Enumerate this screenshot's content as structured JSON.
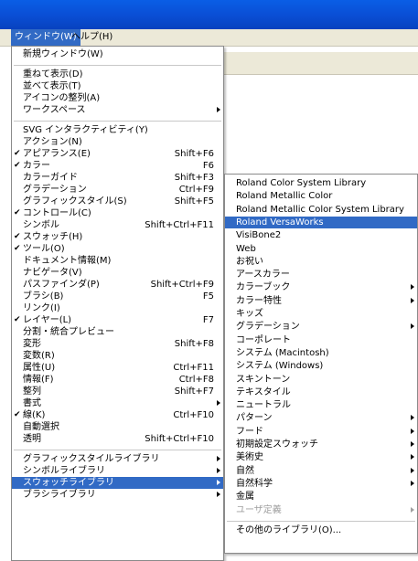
{
  "menubar": {
    "window_label": "ウィンドウ(W)",
    "help_label": "ヘルプ(H)"
  },
  "window_menu": {
    "items": [
      {
        "label": "新規ウィンドウ(W)",
        "shortcut": "",
        "check": false,
        "submenu": false
      },
      {
        "sep": true
      },
      {
        "label": "重ねて表示(D)",
        "shortcut": "",
        "check": false,
        "submenu": false
      },
      {
        "label": "並べて表示(T)",
        "shortcut": "",
        "check": false,
        "submenu": false
      },
      {
        "label": "アイコンの整列(A)",
        "shortcut": "",
        "check": false,
        "submenu": false
      },
      {
        "label": "ワークスペース",
        "shortcut": "",
        "check": false,
        "submenu": true
      },
      {
        "sep": true
      },
      {
        "label": "SVG インタラクティビティ(Y)",
        "shortcut": "",
        "check": false,
        "submenu": false
      },
      {
        "label": "アクション(N)",
        "shortcut": "",
        "check": false,
        "submenu": false
      },
      {
        "label": "アピアランス(E)",
        "shortcut": "Shift+F6",
        "check": true,
        "submenu": false
      },
      {
        "label": "カラー",
        "shortcut": "F6",
        "check": true,
        "submenu": false
      },
      {
        "label": "カラーガイド",
        "shortcut": "Shift+F3",
        "check": false,
        "submenu": false
      },
      {
        "label": "グラデーション",
        "shortcut": "Ctrl+F9",
        "check": false,
        "submenu": false
      },
      {
        "label": "グラフィックスタイル(S)",
        "shortcut": "Shift+F5",
        "check": false,
        "submenu": false
      },
      {
        "label": "コントロール(C)",
        "shortcut": "",
        "check": true,
        "submenu": false
      },
      {
        "label": "シンボル",
        "shortcut": "Shift+Ctrl+F11",
        "check": false,
        "submenu": false
      },
      {
        "label": "スウォッチ(H)",
        "shortcut": "",
        "check": true,
        "submenu": false
      },
      {
        "label": "ツール(O)",
        "shortcut": "",
        "check": true,
        "submenu": false
      },
      {
        "label": "ドキュメント情報(M)",
        "shortcut": "",
        "check": false,
        "submenu": false
      },
      {
        "label": "ナビゲータ(V)",
        "shortcut": "",
        "check": false,
        "submenu": false
      },
      {
        "label": "パスファインダ(P)",
        "shortcut": "Shift+Ctrl+F9",
        "check": false,
        "submenu": false
      },
      {
        "label": "ブラシ(B)",
        "shortcut": "F5",
        "check": false,
        "submenu": false
      },
      {
        "label": "リンク(I)",
        "shortcut": "",
        "check": false,
        "submenu": false
      },
      {
        "label": "レイヤー(L)",
        "shortcut": "F7",
        "check": true,
        "submenu": false
      },
      {
        "label": "分割・統合プレビュー",
        "shortcut": "",
        "check": false,
        "submenu": false
      },
      {
        "label": "変形",
        "shortcut": "Shift+F8",
        "check": false,
        "submenu": false
      },
      {
        "label": "変数(R)",
        "shortcut": "",
        "check": false,
        "submenu": false
      },
      {
        "label": "属性(U)",
        "shortcut": "Ctrl+F11",
        "check": false,
        "submenu": false
      },
      {
        "label": "情報(F)",
        "shortcut": "Ctrl+F8",
        "check": false,
        "submenu": false
      },
      {
        "label": "整列",
        "shortcut": "Shift+F7",
        "check": false,
        "submenu": false
      },
      {
        "label": "書式",
        "shortcut": "",
        "check": false,
        "submenu": true
      },
      {
        "label": "線(K)",
        "shortcut": "Ctrl+F10",
        "check": true,
        "submenu": false
      },
      {
        "label": "自動選択",
        "shortcut": "",
        "check": false,
        "submenu": false
      },
      {
        "label": "透明",
        "shortcut": "Shift+Ctrl+F10",
        "check": false,
        "submenu": false
      },
      {
        "sep": true
      },
      {
        "label": "グラフィックスタイルライブラリ",
        "shortcut": "",
        "check": false,
        "submenu": true
      },
      {
        "label": "シンボルライブラリ",
        "shortcut": "",
        "check": false,
        "submenu": true
      },
      {
        "label": "スウォッチライブラリ",
        "shortcut": "",
        "check": false,
        "submenu": true,
        "highlight": true
      },
      {
        "label": "ブラシライブラリ",
        "shortcut": "",
        "check": false,
        "submenu": true
      }
    ]
  },
  "swatch_submenu": {
    "items": [
      {
        "label": "Roland Color System Library",
        "submenu": false
      },
      {
        "label": "Roland Metallic Color",
        "submenu": false
      },
      {
        "label": "Roland Metallic Color System Library",
        "submenu": false
      },
      {
        "label": "Roland VersaWorks",
        "submenu": false,
        "highlight": true
      },
      {
        "label": "VisiBone2",
        "submenu": false
      },
      {
        "label": "Web",
        "submenu": false
      },
      {
        "label": "お祝い",
        "submenu": false
      },
      {
        "label": "アースカラー",
        "submenu": false
      },
      {
        "label": "カラーブック",
        "submenu": true
      },
      {
        "label": "カラー特性",
        "submenu": true
      },
      {
        "label": "キッズ",
        "submenu": false
      },
      {
        "label": "グラデーション",
        "submenu": true
      },
      {
        "label": "コーポレート",
        "submenu": false
      },
      {
        "label": "システム (Macintosh)",
        "submenu": false
      },
      {
        "label": "システム (Windows)",
        "submenu": false
      },
      {
        "label": "スキントーン",
        "submenu": false
      },
      {
        "label": "テキスタイル",
        "submenu": false
      },
      {
        "label": "ニュートラル",
        "submenu": false
      },
      {
        "label": "パターン",
        "submenu": true
      },
      {
        "label": "フード",
        "submenu": true
      },
      {
        "label": "初期設定スウォッチ",
        "submenu": true
      },
      {
        "label": "美術史",
        "submenu": true
      },
      {
        "label": "自然",
        "submenu": true
      },
      {
        "label": "自然科学",
        "submenu": true
      },
      {
        "label": "金属",
        "submenu": false
      },
      {
        "label": "ユーザ定義",
        "submenu": true,
        "disabled": true
      },
      {
        "sep": true
      },
      {
        "label": "その他のライブラリ(O)...",
        "submenu": false
      }
    ]
  },
  "colors": {
    "titlebar": "#0a4fd6",
    "highlight": "#316ac5",
    "menubar": "#ece9d8"
  }
}
